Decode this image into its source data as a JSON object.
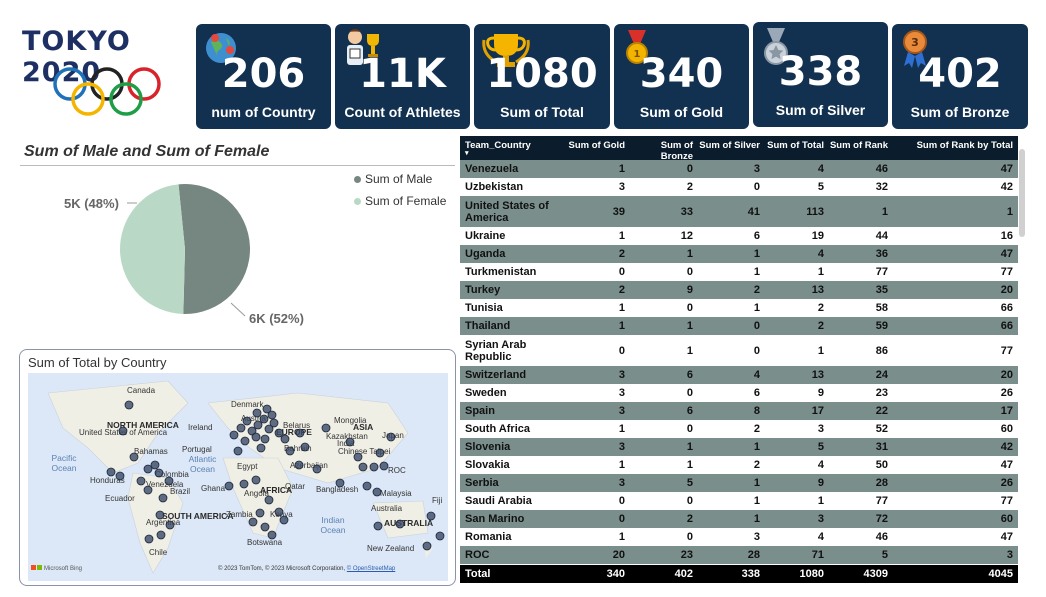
{
  "logo": {
    "title": "TOKYO 2020"
  },
  "kpis": [
    {
      "value": "206",
      "label": "num of Country",
      "icon": "globe-icon"
    },
    {
      "value": "11K",
      "label": "Count of Athletes",
      "icon": "athlete-icon"
    },
    {
      "value": "1080",
      "label": "Sum of Total",
      "icon": "trophy-icon"
    },
    {
      "value": "340",
      "label": "Sum of Gold",
      "icon": "gold-medal-icon"
    },
    {
      "value": "338",
      "label": "Sum of Silver",
      "icon": "silver-medal-icon"
    },
    {
      "value": "402",
      "label": "Sum of Bronze",
      "icon": "bronze-medal-icon"
    }
  ],
  "pie": {
    "title": "Sum of Male and Sum of Female",
    "legend": [
      {
        "label": "Sum of Male",
        "color": "#768781"
      },
      {
        "label": "Sum of Female",
        "color": "#b9d9c6"
      }
    ],
    "female_label": "5K (48%)",
    "male_label": "6K (52%)"
  },
  "chart_data": {
    "type": "pie",
    "title": "Sum of Male and Sum of Female",
    "categories": [
      "Sum of Male",
      "Sum of Female"
    ],
    "values": [
      52,
      48
    ],
    "data_labels": [
      "6K (52%)",
      "5K (48%)"
    ],
    "legend": "top-right"
  },
  "map": {
    "title": "Sum of Total by Country",
    "labels": [
      "Canada",
      "NORTH AMERICA",
      "United States of America",
      "Ireland",
      "Denmark",
      "Mongolia",
      "Kazakhstan",
      "Japan",
      "Pacific Ocean",
      "Bahamas",
      "Portugal",
      "Atlantic Ocean",
      "Egypt",
      "Belarus",
      "ASIA",
      "Chinese Taipei",
      "India",
      "ROC",
      "Honduras",
      "Ecuador",
      "Venezuela",
      "Brazil",
      "Ghana",
      "AFRICA",
      "Angola",
      "Qatar",
      "Bangladesh",
      "Malaysia",
      "Fiji",
      "SOUTH AMERICA",
      "Zambia",
      "Kenya",
      "Indian Ocean",
      "Australia",
      "AUSTRALIA",
      "Argentina",
      "Botswana",
      "New Zealand",
      "Chile",
      "EUROPE",
      "Austria",
      "Bahrain",
      "Azerbaijan",
      "Colombia"
    ],
    "attribution": "© 2023 TomTom, © 2023 Microsoft Corporation,",
    "osm": "© OpenStreetMap",
    "bing": "Microsoft Bing"
  },
  "table": {
    "headers": [
      "Team_Country",
      "Sum of Gold",
      "Sum of Bronze",
      "Sum of Silver",
      "Sum of Total",
      "Sum of Rank",
      "Sum of Rank by Total"
    ],
    "rows": [
      [
        "Venezuela",
        "1",
        "0",
        "3",
        "4",
        "46",
        "47"
      ],
      [
        "Uzbekistan",
        "3",
        "2",
        "0",
        "5",
        "32",
        "42"
      ],
      [
        "United States of America",
        "39",
        "33",
        "41",
        "113",
        "1",
        "1"
      ],
      [
        "Ukraine",
        "1",
        "12",
        "6",
        "19",
        "44",
        "16"
      ],
      [
        "Uganda",
        "2",
        "1",
        "1",
        "4",
        "36",
        "47"
      ],
      [
        "Turkmenistan",
        "0",
        "0",
        "1",
        "1",
        "77",
        "77"
      ],
      [
        "Turkey",
        "2",
        "9",
        "2",
        "13",
        "35",
        "20"
      ],
      [
        "Tunisia",
        "1",
        "0",
        "1",
        "2",
        "58",
        "66"
      ],
      [
        "Thailand",
        "1",
        "1",
        "0",
        "2",
        "59",
        "66"
      ],
      [
        "Syrian Arab Republic",
        "0",
        "1",
        "0",
        "1",
        "86",
        "77"
      ],
      [
        "Switzerland",
        "3",
        "6",
        "4",
        "13",
        "24",
        "20"
      ],
      [
        "Sweden",
        "3",
        "0",
        "6",
        "9",
        "23",
        "26"
      ],
      [
        "Spain",
        "3",
        "6",
        "8",
        "17",
        "22",
        "17"
      ],
      [
        "South Africa",
        "1",
        "0",
        "2",
        "3",
        "52",
        "60"
      ],
      [
        "Slovenia",
        "3",
        "1",
        "1",
        "5",
        "31",
        "42"
      ],
      [
        "Slovakia",
        "1",
        "1",
        "2",
        "4",
        "50",
        "47"
      ],
      [
        "Serbia",
        "3",
        "5",
        "1",
        "9",
        "28",
        "26"
      ],
      [
        "Saudi Arabia",
        "0",
        "0",
        "1",
        "1",
        "77",
        "77"
      ],
      [
        "San Marino",
        "0",
        "2",
        "1",
        "3",
        "72",
        "60"
      ],
      [
        "Romania",
        "1",
        "0",
        "3",
        "4",
        "46",
        "47"
      ],
      [
        "ROC",
        "20",
        "23",
        "28",
        "71",
        "5",
        "3"
      ]
    ],
    "total": [
      "Total",
      "340",
      "402",
      "338",
      "1080",
      "4309",
      "4045"
    ]
  }
}
